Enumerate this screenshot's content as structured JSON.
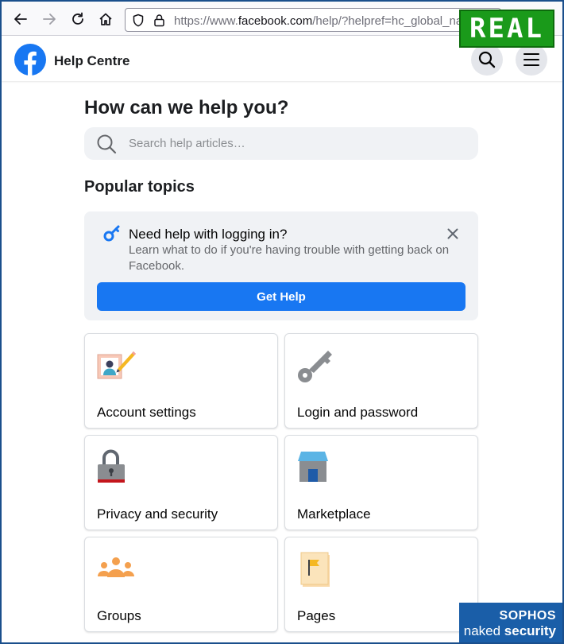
{
  "browser": {
    "url_prefix": "https://www.",
    "url_domain": "facebook.com",
    "url_path": "/help/?helpref=hc_global_nav"
  },
  "watermarks": {
    "real": "REAL",
    "sophos": "SOPHOS",
    "naked": "naked",
    "security": "security"
  },
  "header": {
    "title": "Help Centre",
    "logo_icon": "facebook-logo",
    "search_icon": "search-icon",
    "menu_icon": "hamburger-menu-icon"
  },
  "main": {
    "page_title": "How can we help you?",
    "search_placeholder": "Search help articles…",
    "section_title": "Popular topics"
  },
  "login_card": {
    "heading": "Need help with logging in?",
    "body": "Learn what to do if you're having trouble with getting back on Facebook.",
    "button_label": "Get Help"
  },
  "topics": [
    {
      "label": "Account settings",
      "icon": "account-settings-icon"
    },
    {
      "label": "Login and password",
      "icon": "key-icon"
    },
    {
      "label": "Privacy and security",
      "icon": "padlock-icon"
    },
    {
      "label": "Marketplace",
      "icon": "storefront-icon"
    },
    {
      "label": "Groups",
      "icon": "people-group-icon"
    },
    {
      "label": "Pages",
      "icon": "flag-page-icon"
    }
  ],
  "colors": {
    "brand_blue": "#1877f2",
    "real_green": "#1a9a1a",
    "sophos_blue": "#1a5ea8"
  }
}
